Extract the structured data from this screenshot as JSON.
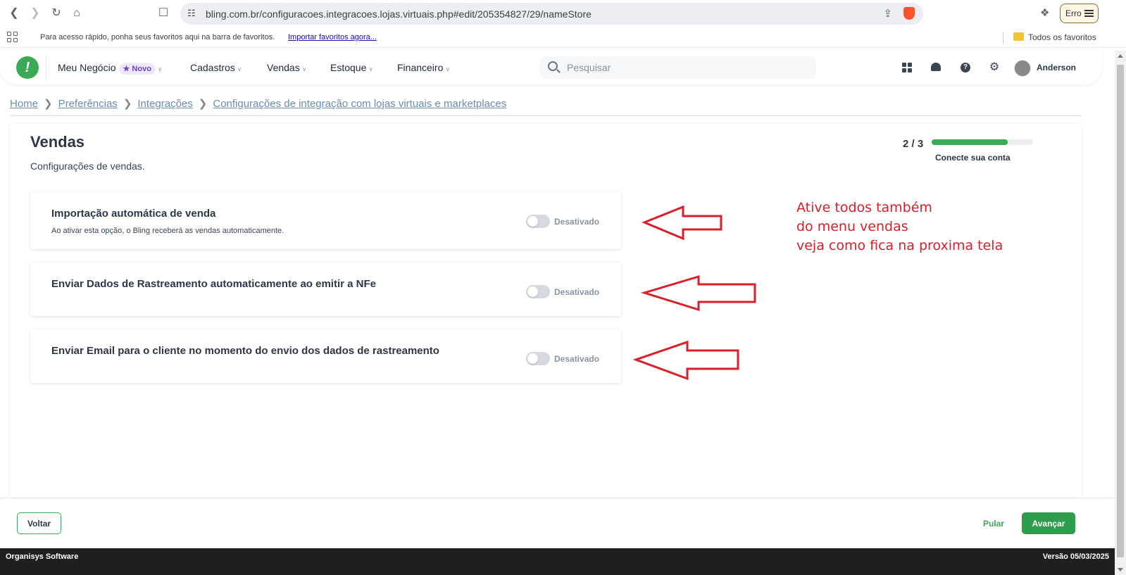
{
  "browser": {
    "url": "bling.com.br/configuracoes.integracoes.lojas.virtuais.php#edit/205354827/29/nameStore",
    "error_button": "Erro",
    "bookmarks_hint": "Para acesso rápido, ponha seus favoritos aqui na barra de favoritos.",
    "bookmarks_import": "Importar favoritos agora...",
    "bookmarks_all": "Todos os favoritos"
  },
  "header": {
    "logo_glyph": "!",
    "menu": [
      {
        "label": "Meu Negócio",
        "badge": "Novo"
      },
      {
        "label": "Cadastros"
      },
      {
        "label": "Vendas"
      },
      {
        "label": "Estoque"
      },
      {
        "label": "Financeiro"
      }
    ],
    "search_placeholder": "Pesquisar",
    "user_name": "Anderson"
  },
  "breadcrumb": [
    "Home",
    "Preferências",
    "Integrações",
    "Configurações de integração com lojas virtuais e marketplaces"
  ],
  "page": {
    "title": "Vendas",
    "subtitle": "Configurações de vendas.",
    "step": "2 / 3",
    "step_progress": 0.75,
    "step_label": "Conecte sua conta"
  },
  "settings": [
    {
      "title": "Importação automática de venda",
      "description": "Ao ativar esta opção, o Bling receberá as vendas automaticamente.",
      "state": "Desativado",
      "enabled": false
    },
    {
      "title": "Enviar Dados de Rastreamento automaticamente ao emitir a NFe",
      "state": "Desativado",
      "enabled": false
    },
    {
      "title": "Enviar Email para o cliente no momento do envio dos dados de rastreamento",
      "state": "Desativado",
      "enabled": false
    }
  ],
  "annotation": {
    "lines": [
      "Ative todos também",
      "do menu vendas",
      "veja como fica na proxima tela"
    ],
    "color": "#d81f2a"
  },
  "footer": {
    "back": "Voltar",
    "skip": "Pular",
    "next": "Avançar",
    "company": "Organisys Software",
    "version": "Versão 05/03/2025"
  },
  "colors": {
    "brand_green": "#3aaa55",
    "link": "#6a8caf"
  }
}
